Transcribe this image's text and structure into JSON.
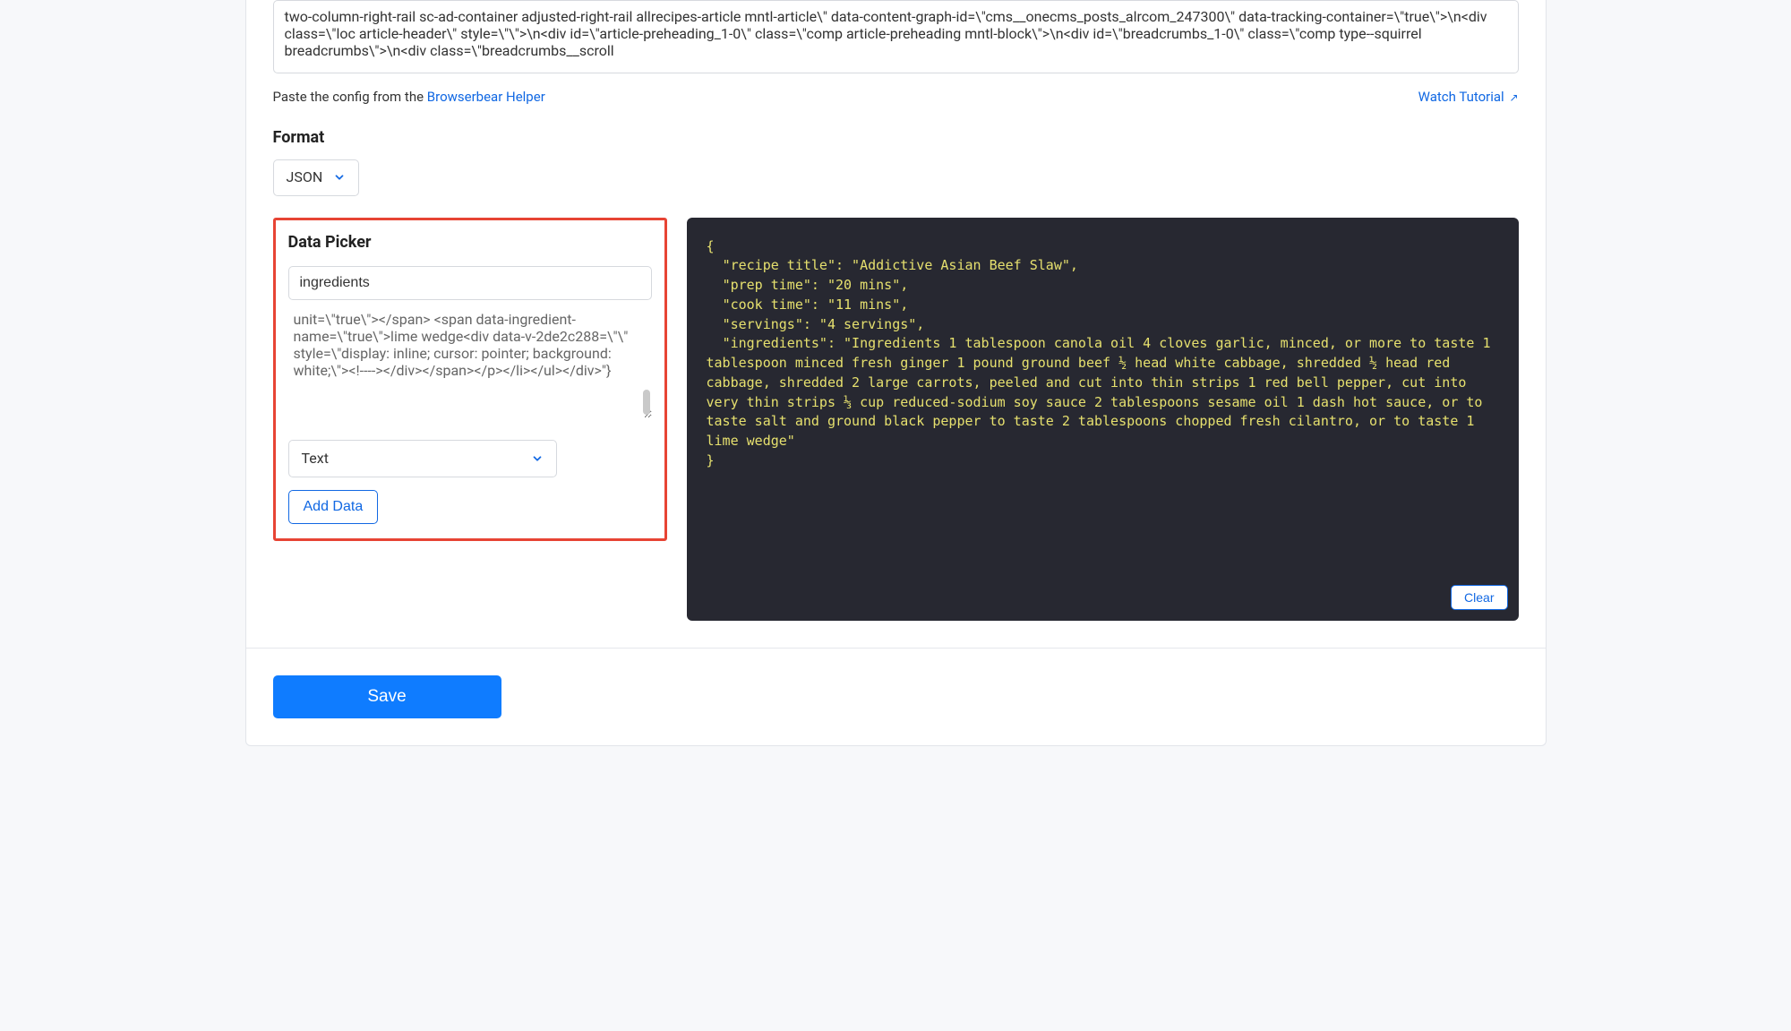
{
  "config": {
    "textarea_value": "two-column-right-rail sc-ad-container adjusted-right-rail allrecipes-article mntl-article\\\" data-content-graph-id=\\\"cms__onecms_posts_alrcom_247300\\\" data-tracking-container=\\\"true\\\">\\n<div class=\\\"loc article-header\\\" style=\\\"\\\">\\n<div id=\\\"article-preheading_1-0\\\" class=\\\"comp article-preheading mntl-block\\\">\\n<div id=\\\"breadcrumbs_1-0\\\" class=\\\"comp type--squirrel breadcrumbs\\\">\\n<div class=\\\"breadcrumbs__scroll",
    "helper_prefix": "Paste the config from the ",
    "helper_link": "Browserbear Helper",
    "tutorial_link": "Watch Tutorial"
  },
  "format": {
    "label": "Format",
    "selected": "JSON"
  },
  "picker": {
    "title": "Data Picker",
    "name_value": "ingredients",
    "html_value": "unit=\\\"true\\\"></span> <span data-ingredient-name=\\\"true\\\">lime wedge<div data-v-2de2c288=\\\"\\\" style=\\\"display: inline; cursor: pointer; background: white;\\\"><!----></div></span></p></li></ul></div>\"}",
    "type_selected": "Text",
    "add_button": "Add Data"
  },
  "output": {
    "json_text": "{\n  \"recipe title\": \"Addictive Asian Beef Slaw\",\n  \"prep time\": \"20 mins\",\n  \"cook time\": \"11 mins\",\n  \"servings\": \"4 servings\",\n  \"ingredients\": \"Ingredients 1 tablespoon canola oil 4 cloves garlic, minced, or more to taste 1 tablespoon minced fresh ginger 1 pound ground beef ½ head white cabbage, shredded ½ head red cabbage, shredded 2 large carrots, peeled and cut into thin strips 1 red bell pepper, cut into very thin strips ⅓ cup reduced-sodium soy sauce 2 tablespoons sesame oil 1 dash hot sauce, or to taste salt and ground black pepper to taste 2 tablespoons chopped fresh cilantro, or to taste 1 lime wedge\"\n}",
    "clear_button": "Clear"
  },
  "actions": {
    "save": "Save"
  }
}
